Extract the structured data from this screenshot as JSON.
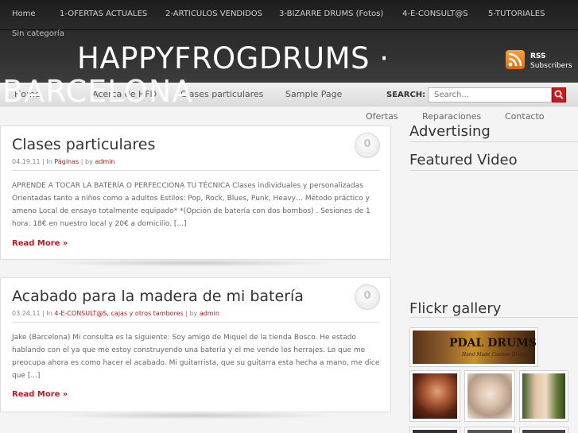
{
  "top_nav": {
    "items": [
      "Home",
      "1-OFERTAS ACTUALES",
      "2-ARTICULOS VENDIDOS",
      "3-BIZARRE DRUMS (Fotos)",
      "4-E-CONSULT@S",
      "5-TUTORIALES"
    ],
    "sub_item": "Sin categoría"
  },
  "header": {
    "title": "HAPPYFROGDRUMS ·",
    "title_line2": "BARCELONA",
    "rss_label": "RSS",
    "rss_sub": "Subscribers"
  },
  "main_nav": {
    "items": [
      "Home",
      "Acerca de HFD",
      "Clases particulares",
      "Sample Page"
    ],
    "search_label": "SEARCH:",
    "search_placeholder": "Search..."
  },
  "second_nav": {
    "items": [
      "Ofertas",
      "Reparaciones",
      "Contacto"
    ]
  },
  "posts": [
    {
      "title": "Clases particulares",
      "date": "04.19.11",
      "in_label": "In",
      "categories": "Páginas",
      "by_label": "by",
      "author": "admin",
      "comments": "0",
      "body": "APRENDE A TOCAR LA BATERÍA O PERFECCIONA TU TÉCNICA Clases individuales y personalizadas Orientadas tanto a niños como a adultos Estilos: Pop, Rock, Blues, Punk, Heavy… Método práctico y ameno Local de ensayo totalmente equipado* *(Opción de batería con dos bombos) . Sesiones de 1 hora: 18€ en nuestro local y 20€ a domicilio. [...]",
      "read_more": "Read More »"
    },
    {
      "title": "Acabado para la madera de mi batería",
      "date": "03.24.11",
      "in_label": "In",
      "categories": "4-E-CONSULT@S, cajas y otros tambores",
      "by_label": "by",
      "author": "admin",
      "comments": "0",
      "body": "Jake (Barcelona) Mi consulta es la siguiente: Soy amigo de Miquel de la tienda Bosco. He estado hablando con el ya que me estoy construyendo una batería y el me vende los herrajes. Lo que me preocupa ahora es como hacer el acabado. Mi guitarrista, que su guitarra esta hecha a mano, me dice que [...]",
      "read_more": "Read More »"
    }
  ],
  "sidebar": {
    "advertising": "Advertising",
    "featured_video": "Featured Video",
    "flickr": "Flickr gallery",
    "banner_text": "PDAL DRUMS",
    "banner_sub": "Hand Made Custom Drums"
  },
  "colors": {
    "accent": "#b21d1d",
    "header_bg": "#2a2a2a",
    "search_button": "#c91d1d"
  }
}
